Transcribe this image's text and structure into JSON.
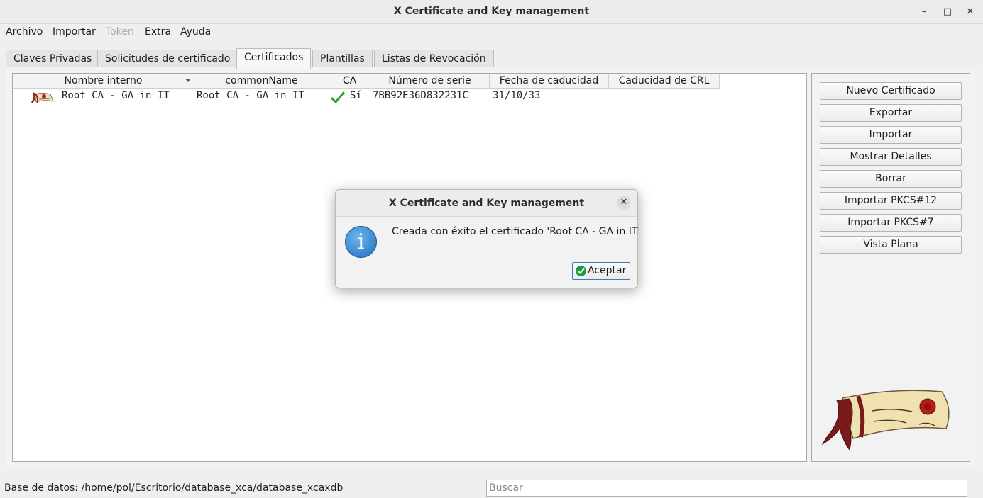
{
  "window": {
    "title": "X Certificate and Key management",
    "controls": [
      "–",
      "□",
      "✕"
    ]
  },
  "menu": [
    {
      "label": "Archivo",
      "enabled": true
    },
    {
      "label": "Importar",
      "enabled": true
    },
    {
      "label": "Token",
      "enabled": false
    },
    {
      "label": "Extra",
      "enabled": true
    },
    {
      "label": "Ayuda",
      "enabled": true
    }
  ],
  "tabs": [
    {
      "label": "Claves Privadas",
      "active": false
    },
    {
      "label": "Solicitudes de certificado",
      "active": false
    },
    {
      "label": "Certificados",
      "active": true
    },
    {
      "label": "Plantillas",
      "active": false
    },
    {
      "label": "Listas de Revocación",
      "active": false
    }
  ],
  "table": {
    "columns": [
      "Nombre interno",
      "commonName",
      "CA",
      "Número de serie",
      "Fecha de caducidad",
      "Caducidad de CRL"
    ],
    "rows": [
      {
        "icon": "certificate-icon",
        "internal_name": "Root CA - GA in IT",
        "common_name": "Root CA - GA in IT",
        "ca": "Sí",
        "serial": "7BB92E36D832231C",
        "expiry": "31/10/33",
        "crl_expiry": ""
      }
    ]
  },
  "actions": [
    "Nuevo Certificado",
    "Exportar",
    "Importar",
    "Mostrar Detalles",
    "Borrar",
    "Importar PKCS#12",
    "Importar PKCS#7",
    "Vista Plana"
  ],
  "status": {
    "database_label": "Base de datos: /home/pol/Escritorio/database_xca/database_xcaxdb",
    "search_placeholder": "Buscar"
  },
  "dialog": {
    "title": "X Certificate and Key management",
    "message": "Creada con éxito el certificado 'Root CA - GA in IT'",
    "icon": "info-icon",
    "ok_label": "Aceptar"
  },
  "colors": {
    "dialog_info": "#1f6fbf",
    "ok_check": "#1e9a3a",
    "logo_ribbon": "#7a1a1a",
    "logo_scroll": "#f0e2b0"
  }
}
